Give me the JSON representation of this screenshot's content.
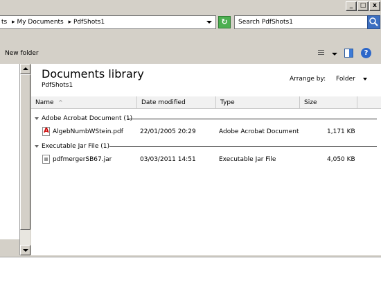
{
  "window": {
    "minimize": "_",
    "maximize": "□",
    "close": "x"
  },
  "address": {
    "crumbs": [
      "ts",
      "▸ My Documents",
      "▸ PdfShots1"
    ]
  },
  "search": {
    "placeholder": "Search PdfShots1"
  },
  "toolbar": {
    "new_folder": "New folder",
    "help": "?"
  },
  "library": {
    "title": "Documents library",
    "subtitle": "PdfShots1",
    "arrange_label": "Arrange by:",
    "arrange_value": "Folder"
  },
  "columns": [
    "Name",
    "Date modified",
    "Type",
    "Size"
  ],
  "groups": [
    {
      "label": "Adobe Acrobat Document (1)",
      "files": [
        {
          "name": "AlgebNumbWStein.pdf",
          "modified": "22/01/2005 20:29",
          "type": "Adobe Acrobat Document",
          "size": "1,171 KB",
          "icon": "pdf-file-icon"
        }
      ]
    },
    {
      "label": "Executable Jar File (1)",
      "files": [
        {
          "name": "pdfmergerSB67.jar",
          "modified": "03/03/2011 14:51",
          "type": "Executable Jar File",
          "size": "4,050 KB",
          "icon": "jar-file-icon"
        }
      ]
    }
  ],
  "colors": {
    "chrome": "#d4d0c8",
    "accent": "#3c6fc1",
    "pdf_red": "#cc0000"
  }
}
